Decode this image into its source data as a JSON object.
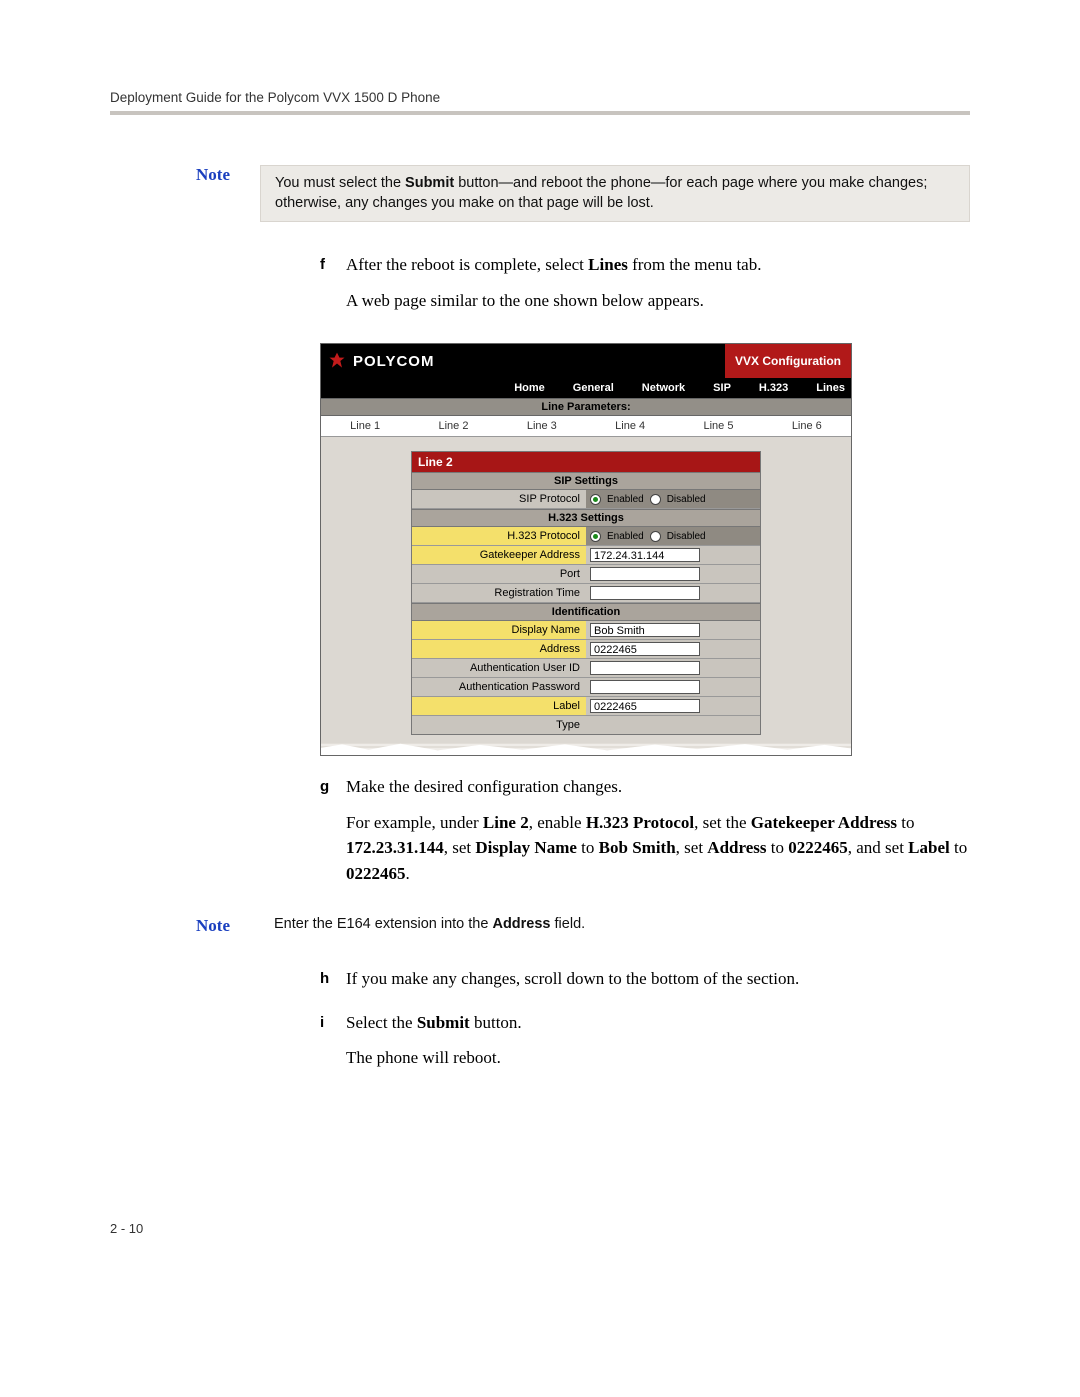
{
  "header": {
    "title": "Deployment Guide for the Polycom VVX 1500 D Phone"
  },
  "note1": {
    "label": "Note",
    "pre": "You must select the ",
    "button": "Submit",
    "post": " button—and reboot the phone—for each page where you make changes; otherwise, any changes you make on that page will be lost."
  },
  "step_f": {
    "letter": "f",
    "l1a": "After the reboot is complete, select ",
    "l1b": "Lines",
    "l1c": " from the menu tab.",
    "l2": "A web page similar to the one shown below appears."
  },
  "figure": {
    "logo_text": "POLYCOM",
    "config_title": "VVX Configuration",
    "nav": [
      "Home",
      "General",
      "Network",
      "SIP",
      "H.323",
      "Lines"
    ],
    "line_params_title": "Line Parameters:",
    "lines": [
      "Line 1",
      "Line 2",
      "Line 3",
      "Line 4",
      "Line 5",
      "Line 6"
    ],
    "panel_title": "Line 2",
    "sip_head": "SIP Settings",
    "sip_proto_label": "SIP Protocol",
    "enabled": "Enabled",
    "disabled": "Disabled",
    "h323_head": "H.323 Settings",
    "h323_proto_label": "H.323 Protocol",
    "gk_label": "Gatekeeper Address",
    "gk_value": "172.24.31.144",
    "port_label": "Port",
    "regtime_label": "Registration Time",
    "ident_head": "Identification",
    "dispname_label": "Display Name",
    "dispname_value": "Bob Smith",
    "address_label": "Address",
    "address_value": "0222465",
    "authuid_label": "Authentication User ID",
    "authpw_label": "Authentication Password",
    "label_label": "Label",
    "label_value": "0222465",
    "type_label": "Type"
  },
  "step_g": {
    "letter": "g",
    "l1": "Make the desired configuration changes.",
    "l2a": "For example, under ",
    "l2b": "Line 2",
    "l2c": ", enable ",
    "l2d": "H.323 Protocol",
    "l2e": ", set the ",
    "l2f": "Gatekeeper Address",
    "l2g": " to ",
    "l2h": "172.23.31.144",
    "l2i": ", set ",
    "l2j": "Display Name",
    "l2k": " to ",
    "l2l": "Bob Smith",
    "l2m": ", set ",
    "l2n": "Address",
    "l2o": " to ",
    "l2p": "0222465",
    "l2q": ", and set ",
    "l2r": "Label",
    "l2s": " to ",
    "l2t": "0222465",
    "l2u": "."
  },
  "note2": {
    "label": "Note",
    "pre": "Enter the E164 extension into the ",
    "bold": "Address",
    "post": " field."
  },
  "step_h": {
    "letter": "h",
    "l1": "If you make any changes, scroll down to the bottom of the section."
  },
  "step_i": {
    "letter": "i",
    "l1a": "Select the ",
    "l1b": "Submit",
    "l1c": " button.",
    "l2": "The phone will reboot."
  },
  "page_num": "2 - 10"
}
